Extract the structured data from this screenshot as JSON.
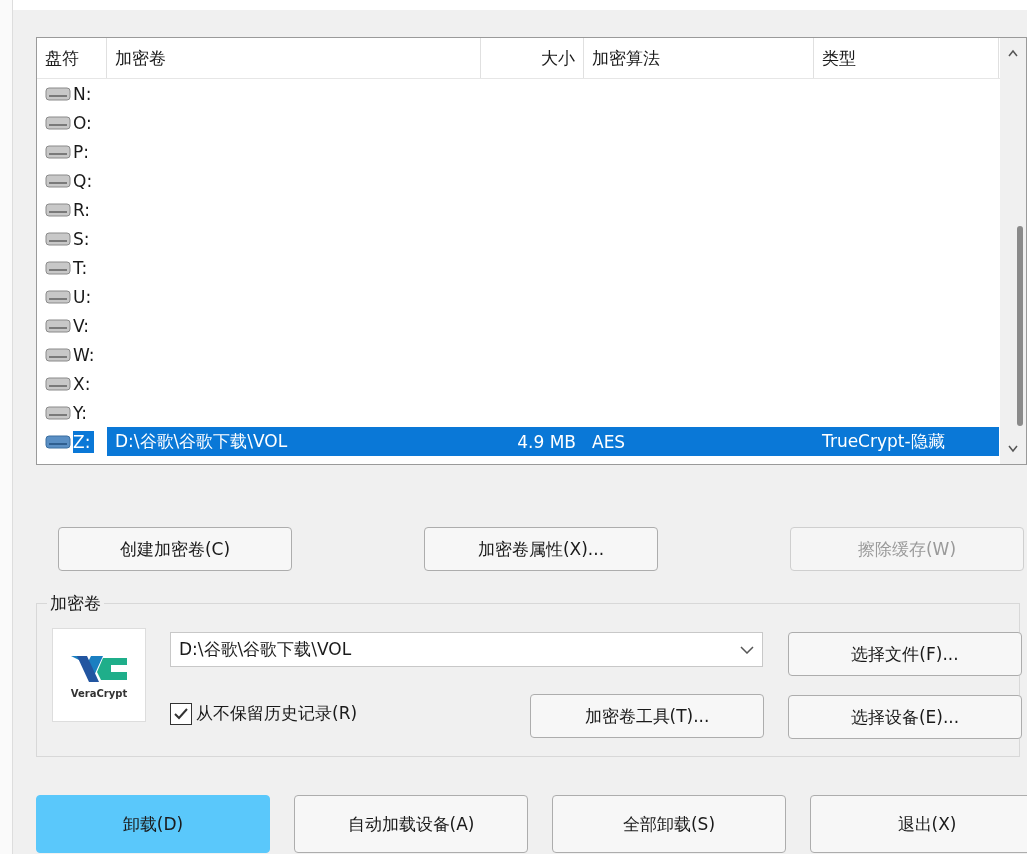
{
  "table": {
    "columns": [
      "盘符",
      "加密卷",
      "大小",
      "加密算法",
      "类型"
    ],
    "rows": [
      {
        "drive": "N:",
        "selected": false
      },
      {
        "drive": "O:",
        "selected": false
      },
      {
        "drive": "P:",
        "selected": false
      },
      {
        "drive": "Q:",
        "selected": false
      },
      {
        "drive": "R:",
        "selected": false
      },
      {
        "drive": "S:",
        "selected": false
      },
      {
        "drive": "T:",
        "selected": false
      },
      {
        "drive": "U:",
        "selected": false
      },
      {
        "drive": "V:",
        "selected": false
      },
      {
        "drive": "W:",
        "selected": false
      },
      {
        "drive": "X:",
        "selected": false
      },
      {
        "drive": "Y:",
        "selected": false
      },
      {
        "drive": "Z:",
        "volume": "D:\\谷歌\\谷歌下载\\VOL",
        "size": "4.9 MB",
        "algorithm": "AES",
        "type": "TrueCrypt-隐藏",
        "selected": true
      }
    ]
  },
  "action_buttons": [
    {
      "label": "创建加密卷(C)",
      "disabled": false
    },
    {
      "label": "加密卷属性(X)...",
      "disabled": false
    },
    {
      "label": "擦除缓存(W)",
      "disabled": true
    }
  ],
  "volume_group": {
    "title": "加密卷",
    "logo_text": "VeraCrypt",
    "path": "D:\\谷歌\\谷歌下载\\VOL",
    "never_save_history": {
      "label": "从不保留历史记录(R)",
      "checked": true
    },
    "buttons": [
      {
        "label": "选择文件(F)...",
        "kind": "side"
      },
      {
        "label": "加密卷工具(T)...",
        "kind": "tool"
      },
      {
        "label": "选择设备(E)...",
        "kind": "side"
      }
    ]
  },
  "bottom_buttons": [
    {
      "label": "卸载(D)",
      "selected": true
    },
    {
      "label": "自动加载设备(A)",
      "selected": false
    },
    {
      "label": "全部卸载(S)",
      "selected": false
    },
    {
      "label": "退出(X)",
      "selected": false
    }
  ]
}
